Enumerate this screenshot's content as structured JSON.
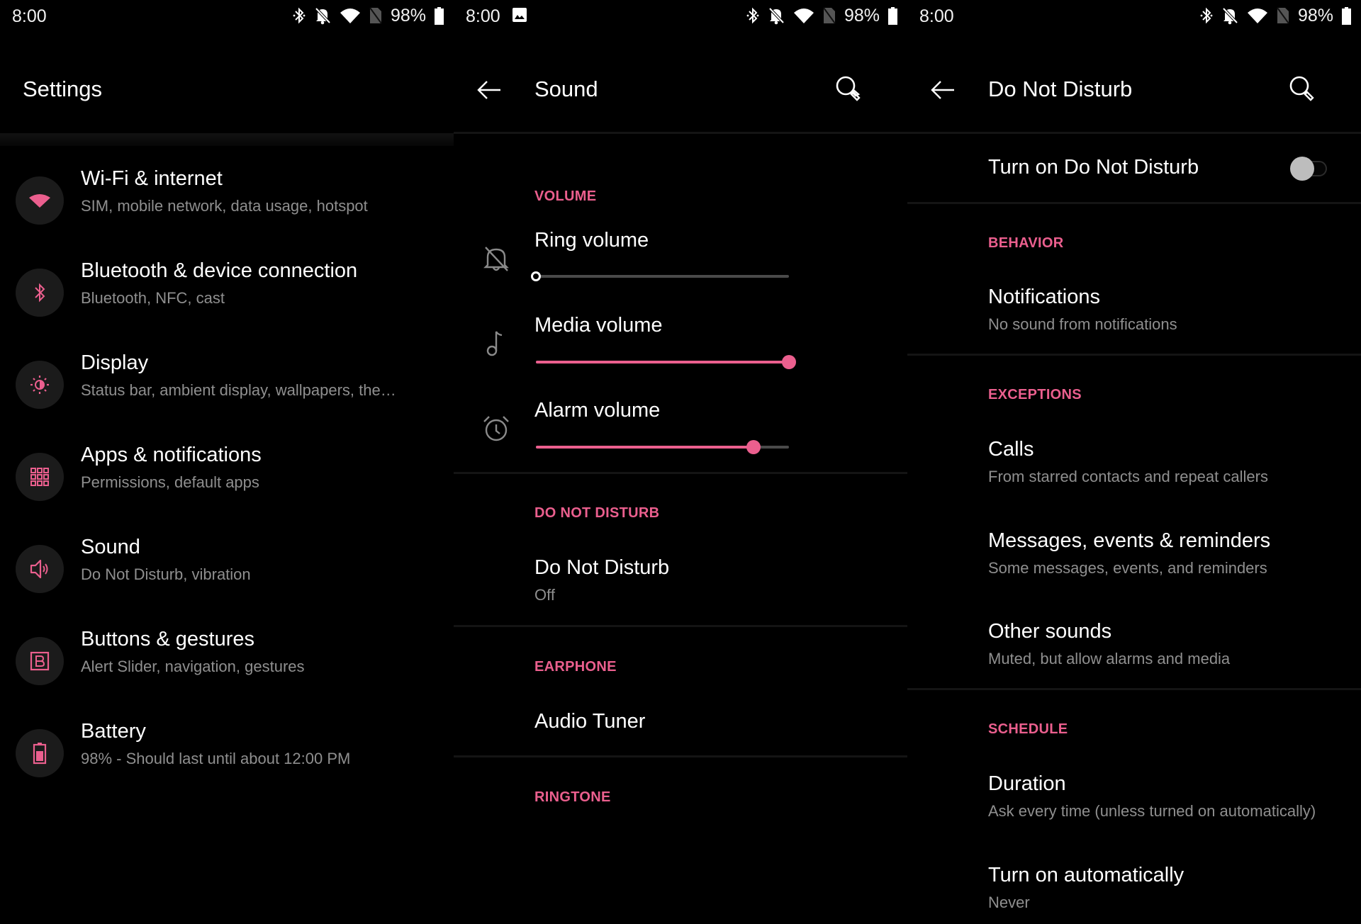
{
  "accent_color": "#eb5f8e",
  "status_bar": {
    "time": "8:00",
    "battery_percent": "98%",
    "icons": [
      "bluetooth-icon",
      "bell-off-icon",
      "wifi-icon",
      "no-sim-icon",
      "battery-icon"
    ]
  },
  "settings": {
    "title": "Settings",
    "items": [
      {
        "title": "Wi-Fi & internet",
        "subtitle": "SIM, mobile network, data usage, hotspot",
        "icon": "wifi-icon"
      },
      {
        "title": "Bluetooth & device connection",
        "subtitle": "Bluetooth, NFC, cast",
        "icon": "bluetooth-icon"
      },
      {
        "title": "Display",
        "subtitle": "Status bar, ambient display, wallpapers, the…",
        "icon": "brightness-icon"
      },
      {
        "title": "Apps & notifications",
        "subtitle": "Permissions, default apps",
        "icon": "apps-grid-icon"
      },
      {
        "title": "Sound",
        "subtitle": "Do Not Disturb, vibration",
        "icon": "speaker-icon"
      },
      {
        "title": "Buttons & gestures",
        "subtitle": "Alert Slider, navigation, gestures",
        "icon": "button-b-icon"
      },
      {
        "title": "Battery",
        "subtitle": "98% - Should last until about 12:00 PM",
        "icon": "battery-icon"
      }
    ]
  },
  "sound": {
    "title": "Sound",
    "volume_section": "VOLUME",
    "sliders": [
      {
        "label": "Ring volume",
        "value": 0.0,
        "icon": "bell-off-icon"
      },
      {
        "label": "Media volume",
        "value": 1.0,
        "icon": "music-note-icon"
      },
      {
        "label": "Alarm volume",
        "value": 0.86,
        "icon": "alarm-clock-icon"
      }
    ],
    "dnd_section": "DO NOT DISTURB",
    "dnd_item": {
      "title": "Do Not Disturb",
      "subtitle": "Off"
    },
    "earphone_section": "EARPHONE",
    "audio_tuner": "Audio Tuner",
    "ringtone_section": "RINGTONE"
  },
  "dnd": {
    "title": "Do Not Disturb",
    "toggle_label": "Turn on Do Not Disturb",
    "toggle_on": false,
    "behavior_section": "BEHAVIOR",
    "notifications": {
      "title": "Notifications",
      "subtitle": "No sound from notifications"
    },
    "exceptions_section": "EXCEPTIONS",
    "calls": {
      "title": "Calls",
      "subtitle": "From starred contacts and repeat callers"
    },
    "messages": {
      "title": "Messages, events & reminders",
      "subtitle": "Some messages, events, and reminders"
    },
    "other": {
      "title": "Other sounds",
      "subtitle": "Muted, but allow alarms and media"
    },
    "schedule_section": "SCHEDULE",
    "duration": {
      "title": "Duration",
      "subtitle": "Ask every time (unless turned on automatically)"
    },
    "auto": {
      "title": "Turn on automatically",
      "subtitle": "Never"
    }
  }
}
